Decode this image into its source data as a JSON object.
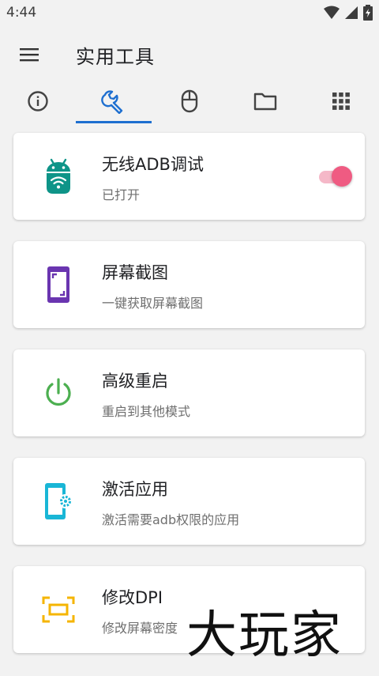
{
  "status_bar": {
    "time": "4:44"
  },
  "app_bar": {
    "title": "实用工具"
  },
  "tabs": [
    {
      "name": "info",
      "icon": "info-icon"
    },
    {
      "name": "tools",
      "icon": "wrench-icon",
      "selected": true
    },
    {
      "name": "mouse",
      "icon": "mouse-icon"
    },
    {
      "name": "files",
      "icon": "folder-icon"
    },
    {
      "name": "apps",
      "icon": "grid-icon"
    }
  ],
  "cards": [
    {
      "title": "无线ADB调试",
      "subtitle": "已打开",
      "icon": "android-wifi-icon",
      "icon_color": "#0e9488",
      "toggle_on": true
    },
    {
      "title": "屏幕截图",
      "subtitle": "一键获取屏幕截图",
      "icon": "screenshot-icon",
      "icon_color": "#6a35b0"
    },
    {
      "title": "高级重启",
      "subtitle": "重启到其他模式",
      "icon": "power-icon",
      "icon_color": "#4caf50"
    },
    {
      "title": "激活应用",
      "subtitle": "激活需要adb权限的应用",
      "icon": "phone-settings-icon",
      "icon_color": "#19b6d6"
    },
    {
      "title": "修改DPI",
      "subtitle": "修改屏幕密度",
      "icon": "dpi-frame-icon",
      "icon_color": "#f5b500"
    }
  ],
  "colors": {
    "accent": "#1e6fd0",
    "toggle_on": "#ef5b82",
    "background": "#f2f2f2"
  },
  "watermark": "大玩家"
}
